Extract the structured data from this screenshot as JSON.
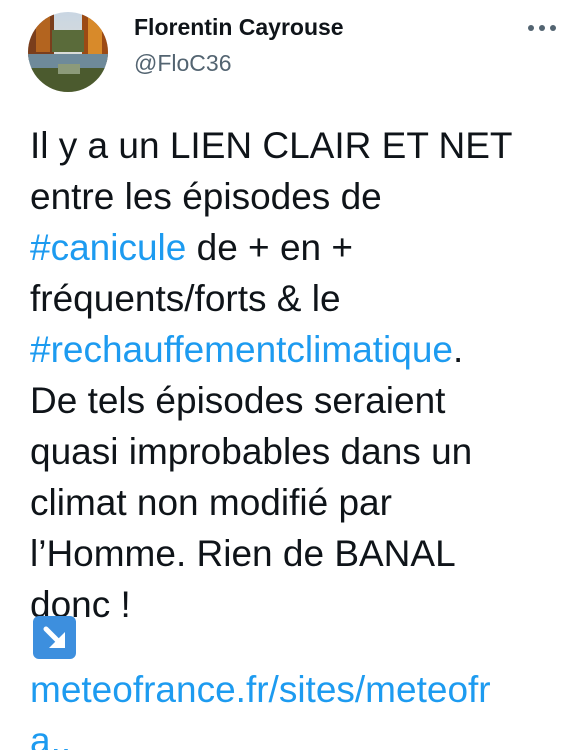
{
  "author": {
    "name": "Florentin Cayrouse",
    "handle": "@FloC36"
  },
  "more_icon": "more-horizontal-icon",
  "tweet": {
    "lines": [
      "Il y a un LIEN CLAIR ET NET",
      "entre les épisodes de"
    ],
    "hashtag1": "#canicule",
    "after_hashtag1": " de + en +",
    "line4": "fréquents/forts & le",
    "hashtag2": "#rechauffementclimatique",
    "after_hashtag2": ".",
    "lines_after": [
      "De tels épisodes seraient",
      "quasi improbables dans un",
      "climat non modifié par",
      "l’Homme. Rien de BANAL",
      "donc !"
    ],
    "arrow_icon": "arrow-down-right-emoji-icon",
    "link_line1": "meteofrance.fr/sites/meteofr",
    "link_line2": "a.."
  },
  "colors": {
    "link": "#1d9bf0",
    "text": "#0f1419",
    "secondary": "#536471",
    "emoji_bg": "#3d8fde"
  }
}
